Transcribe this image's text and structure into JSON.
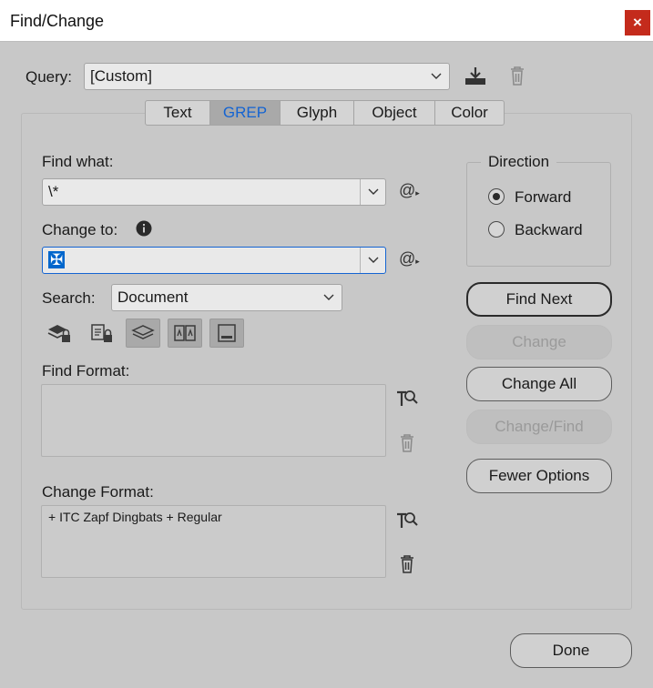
{
  "window": {
    "title": "Find/Change",
    "close_glyph": "×"
  },
  "query": {
    "label": "Query:",
    "value": "[Custom]"
  },
  "tabs": [
    {
      "label": "Text"
    },
    {
      "label": "GREP",
      "active": true
    },
    {
      "label": "Glyph"
    },
    {
      "label": "Object"
    },
    {
      "label": "Color"
    }
  ],
  "find_what": {
    "label": "Find what:",
    "value": "\\*",
    "special_glyph": "@"
  },
  "change_to": {
    "label": "Change to:",
    "value": "✠",
    "special_glyph": "@"
  },
  "search": {
    "label": "Search:",
    "value": "Document"
  },
  "find_format": {
    "label": "Find Format:",
    "value": ""
  },
  "change_format": {
    "label": "Change Format:",
    "value": "+ ITC Zapf Dingbats + Regular"
  },
  "direction": {
    "legend": "Direction",
    "options": [
      {
        "label": "Forward",
        "checked": true
      },
      {
        "label": "Backward",
        "checked": false
      }
    ]
  },
  "buttons": {
    "find_next": "Find Next",
    "change": "Change",
    "change_all": "Change All",
    "change_find": "Change/Find",
    "fewer_options": "Fewer Options",
    "done": "Done"
  },
  "colors": {
    "active_tab_text": "#1464d2",
    "selection": "#0066cc",
    "close": "#c42b1c"
  }
}
